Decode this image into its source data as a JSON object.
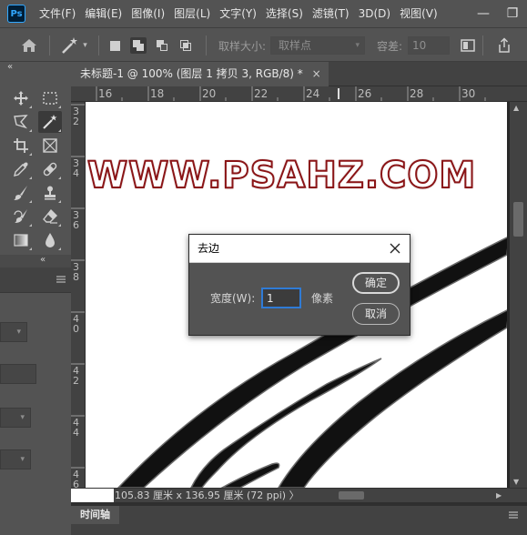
{
  "app": {
    "logo_text": "Ps"
  },
  "menubar": {
    "items": [
      "文件(F)",
      "编辑(E)",
      "图像(I)",
      "图层(L)",
      "文字(Y)",
      "选择(S)",
      "滤镜(T)",
      "3D(D)",
      "视图(V)"
    ],
    "window_buttons": {
      "minimize": "—",
      "restore": "❐"
    }
  },
  "optionsbar": {
    "sample_size_label": "取样大小:",
    "sample_size_value": "取样点",
    "tolerance_label": "容差:",
    "tolerance_value": "10"
  },
  "panels": {
    "tools_collapse": "«",
    "lower_collapse": "«"
  },
  "document": {
    "tab_title": "未标题-1 @ 100% (图层 1 拷贝 3, RGB/8) *",
    "tab_close": "×",
    "watermark_text": "WWW.PSAHZ.COM",
    "ruler_top_labels": [
      "16",
      "18",
      "20",
      "22",
      "24",
      "26",
      "28",
      "30"
    ],
    "ruler_left_labels": [
      "3 2",
      "3 4",
      "3 6",
      "3 8",
      "4 0",
      "4 2",
      "4 4",
      "4 6"
    ]
  },
  "statusbar": {
    "size_text": "105.83 厘米 x 136.95 厘米 (72 ppi)",
    "more_arrow": "〉"
  },
  "timeline": {
    "label": "时间轴"
  },
  "dialog": {
    "title": "去边",
    "width_label": "宽度(W):",
    "width_value": "1",
    "unit_label": "像素",
    "ok_label": "确定",
    "cancel_label": "取消"
  }
}
